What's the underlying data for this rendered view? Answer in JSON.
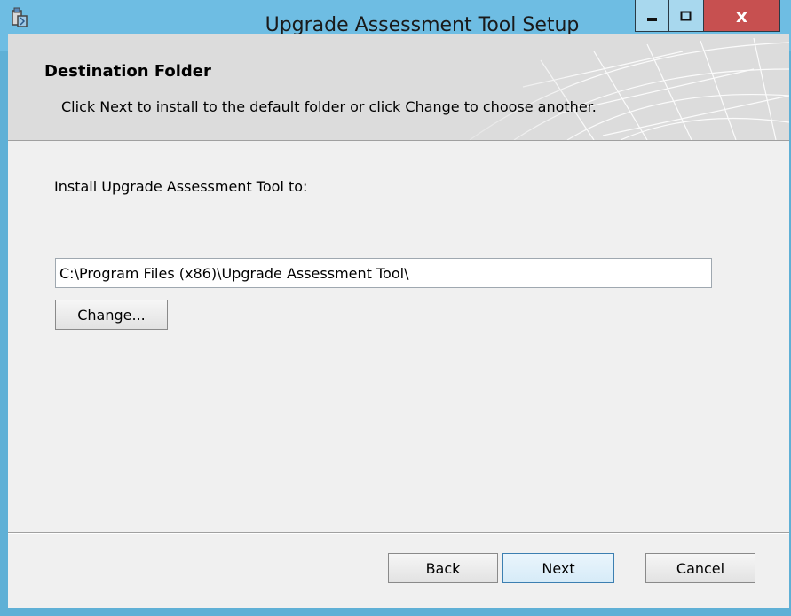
{
  "window": {
    "title": "Upgrade Assessment Tool Setup",
    "icons": {
      "app": "installer-icon",
      "minimize": "minimize-icon",
      "maximize": "maximize-icon",
      "close": "close-icon"
    },
    "close_symbol": "x"
  },
  "banner": {
    "title": "Destination Folder",
    "description": "Click Next to install to the default folder or click Change to choose another."
  },
  "body": {
    "install_label": "Install Upgrade Assessment Tool to:",
    "path_value": "C:\\Program Files (x86)\\Upgrade Assessment Tool\\",
    "change_label": "Change..."
  },
  "footer": {
    "back_label": "Back",
    "next_label": "Next",
    "cancel_label": "Cancel"
  },
  "colors": {
    "titlebar": "#6ebde3",
    "close_button": "#c75050",
    "client_background": "#f0f0f0"
  }
}
